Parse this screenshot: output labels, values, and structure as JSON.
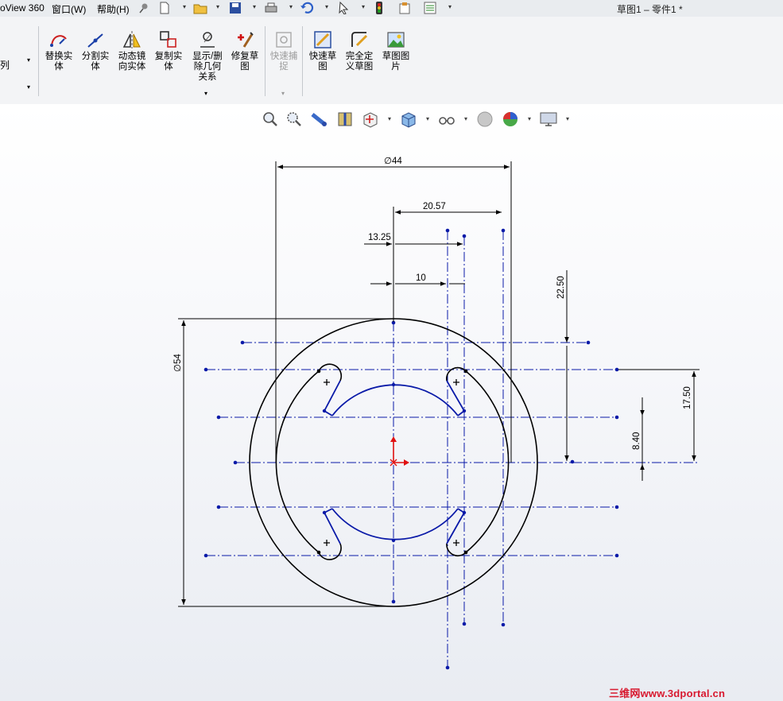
{
  "menubar": {
    "app_fragment": "oView 360",
    "window_menu": "窗口(W)",
    "help_menu": "帮助(H)",
    "doc_title": "草图1 – 零件1 *"
  },
  "ribbon": {
    "left_fragment": "列",
    "buttons": [
      {
        "label": "替换实\n体"
      },
      {
        "label": "分割实\n体"
      },
      {
        "label": "动态镜\n向实体"
      },
      {
        "label": "复制实\n体"
      },
      {
        "label": "显示/删\n除几何\n关系"
      },
      {
        "label": "修复草\n图"
      },
      {
        "label": "快速捕\n捉"
      },
      {
        "label": "快速草\n图"
      },
      {
        "label": "完全定\n义草图"
      },
      {
        "label": "草图图\n片"
      }
    ]
  },
  "dimensions": {
    "outer_diameter": "44",
    "dim_20_57": "20.57",
    "dim_13_25": "13.25",
    "dim_10": "10",
    "dim_22_50": "22.50",
    "big_diameter": "54",
    "dim_17_50": "17.50",
    "dim_8_40": "8.40",
    "diameter_symbol": "∅"
  },
  "colors": {
    "sketch_blue": "#0a1aa8",
    "origin_red": "#e01010",
    "watermark_red": "#d8192f"
  },
  "watermark": "三维网www.3dportal.cn"
}
